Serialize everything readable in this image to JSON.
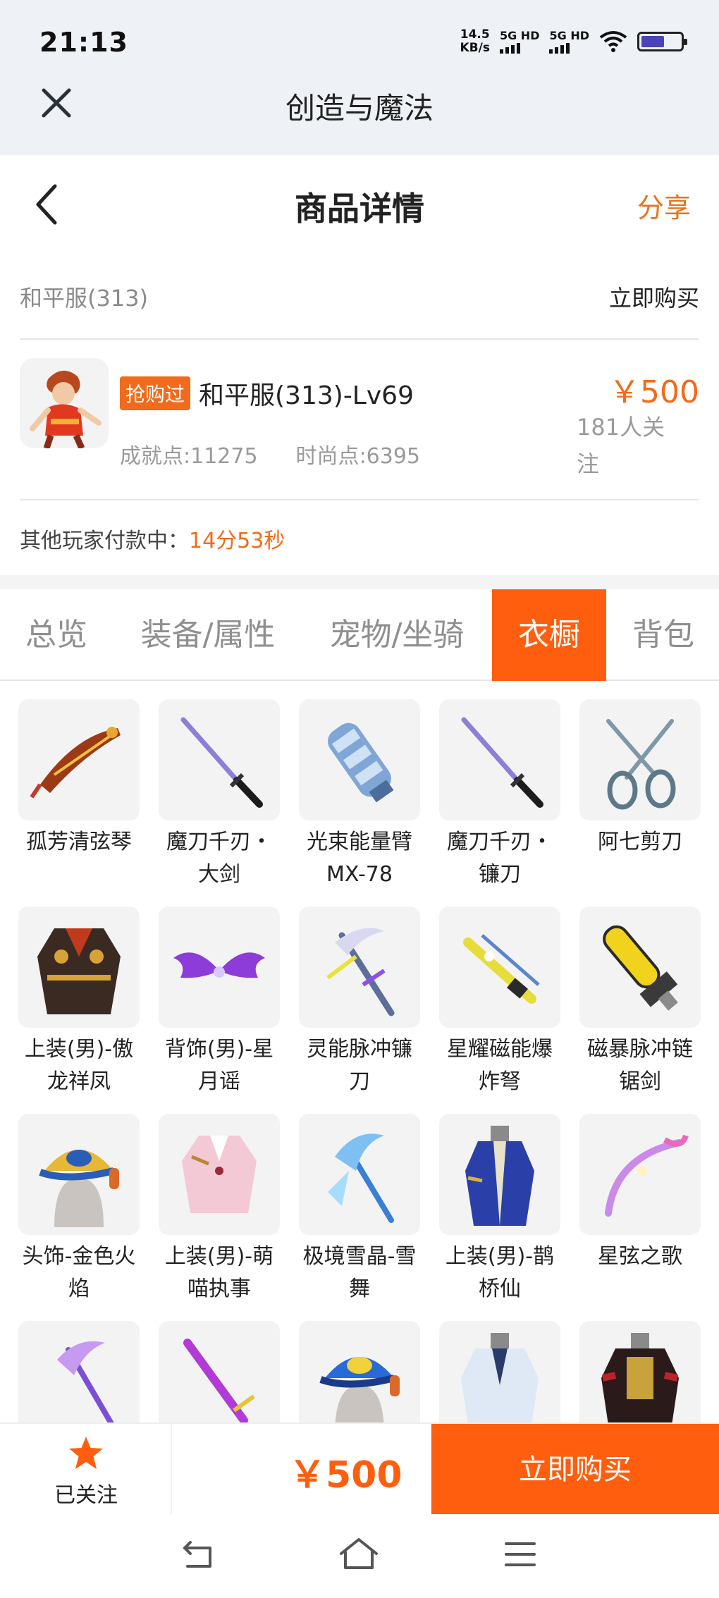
{
  "status_bar": {
    "time": "21:13",
    "net_speed_value": "14.5",
    "net_speed_unit": "KB/s",
    "sim1_label": "5G HD",
    "sim2_label": "5G HD"
  },
  "app_bar": {
    "title": "创造与魔法"
  },
  "header": {
    "title": "商品详情",
    "share_label": "分享"
  },
  "server": {
    "name": "和平服(313)",
    "buy_now_label": "立即购买"
  },
  "product": {
    "badge": "抢购过",
    "name": "和平服(313)-Lv69",
    "achievement": "成就点:11275",
    "fashion": "时尚点:6395",
    "price": "￥500",
    "followers": "181人关注"
  },
  "payment_status": {
    "label": "其他玩家付款中：",
    "countdown": "14分53秒"
  },
  "tabs": [
    {
      "label": "总览",
      "active": false
    },
    {
      "label": "装备/属性",
      "active": false
    },
    {
      "label": "宠物/坐骑",
      "active": false
    },
    {
      "label": "衣橱",
      "active": true
    },
    {
      "label": "背包",
      "active": false
    }
  ],
  "wardrobe_items": [
    {
      "name": "孤芳清弦琴",
      "icon": "guqin-weapon-icon"
    },
    {
      "name": "魔刀千刃・大剑",
      "icon": "katana-icon"
    },
    {
      "name": "光束能量臂MX-78",
      "icon": "energy-arm-icon"
    },
    {
      "name": "魔刀千刃・镰刀",
      "icon": "katana-icon"
    },
    {
      "name": "阿七剪刀",
      "icon": "scissors-icon"
    },
    {
      "name": "上装(男)-傲龙祥凤",
      "icon": "dragon-robe-icon"
    },
    {
      "name": "背饰(男)-星月谣",
      "icon": "wings-icon"
    },
    {
      "name": "灵能脉冲镰刀",
      "icon": "pulse-scythe-icon"
    },
    {
      "name": "星耀磁能爆炸弩",
      "icon": "crossbow-icon"
    },
    {
      "name": "磁暴脉冲链锯剑",
      "icon": "chainsaw-sword-icon"
    },
    {
      "name": "头饰-金色火焰",
      "icon": "gold-cap-icon"
    },
    {
      "name": "上装(男)-萌喵执事",
      "icon": "butler-outfit-icon"
    },
    {
      "name": "极境雪晶-雪舞",
      "icon": "ice-scythe-icon"
    },
    {
      "name": "上装(男)-鹊桥仙",
      "icon": "blue-robe-icon"
    },
    {
      "name": "星弦之歌",
      "icon": "star-bow-icon"
    },
    {
      "name": "",
      "icon": "purple-scythe-icon"
    },
    {
      "name": "",
      "icon": "purple-sword-icon"
    },
    {
      "name": "",
      "icon": "blue-cap-icon"
    },
    {
      "name": "",
      "icon": "white-coat-icon"
    },
    {
      "name": "",
      "icon": "dark-jacket-icon"
    }
  ],
  "bottom_bar": {
    "follow_label": "已关注",
    "price": "￥500",
    "buy_label": "立即购买"
  },
  "colors": {
    "accent": "#ff5e0e",
    "price_orange": "#f26a1b",
    "share_orange": "#e8731c",
    "status_bg": "#eef1f6"
  }
}
